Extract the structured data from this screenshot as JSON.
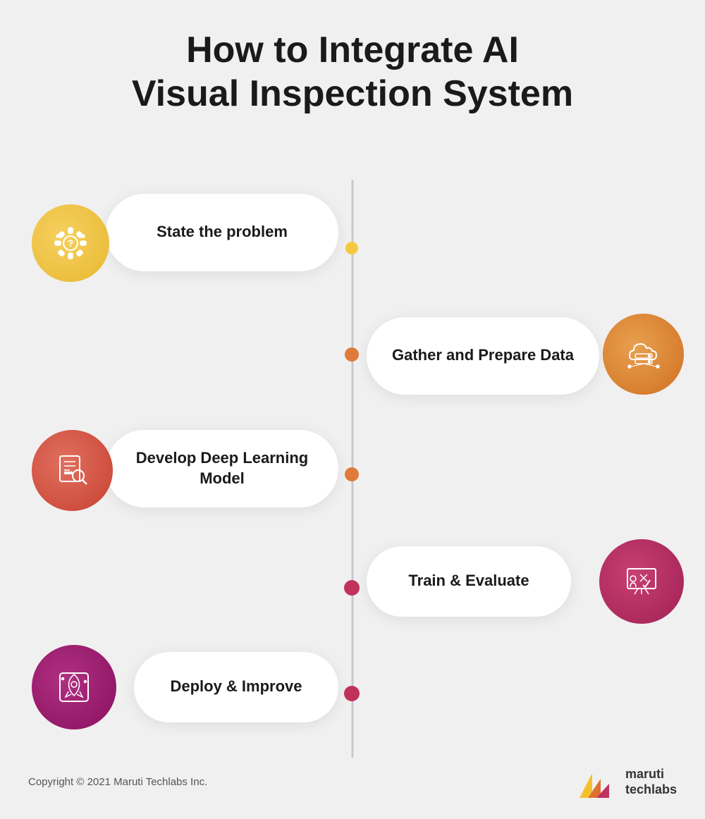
{
  "title": {
    "line1": "How to Integrate AI",
    "line2": "Visual Inspection System"
  },
  "steps": [
    {
      "id": 1,
      "label": "State the problem",
      "side": "left",
      "icon": "problem-icon",
      "icon_color": "#e8b830",
      "dot_color": "#f5c842"
    },
    {
      "id": 2,
      "label": "Gather and Prepare Data",
      "side": "right",
      "icon": "data-icon",
      "icon_color": "#d07020",
      "dot_color": "#e07a3a"
    },
    {
      "id": 3,
      "label": "Develop Deep Learning Model",
      "side": "left",
      "icon": "model-icon",
      "icon_color": "#c84030",
      "dot_color": "#e07a3a"
    },
    {
      "id": 4,
      "label": "Train & Evaluate",
      "side": "right",
      "icon": "train-icon",
      "icon_color": "#a02055",
      "dot_color": "#c0325a"
    },
    {
      "id": 5,
      "label": "Deploy & Improve",
      "side": "left",
      "icon": "deploy-icon",
      "icon_color": "#8a1060",
      "dot_color": "#c0325a"
    }
  ],
  "footer": {
    "copyright": "Copyright © 2021 Maruti Techlabs Inc.",
    "logo_name": "maruti\ntechlabs"
  }
}
